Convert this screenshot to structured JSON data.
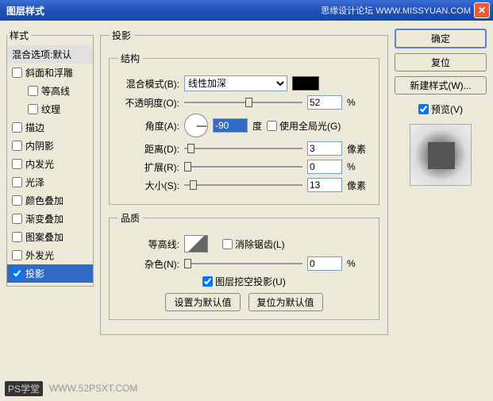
{
  "title": "图层样式",
  "brand": "思缘设计论坛  WWW.MISSYUAN.COM",
  "sidebar": {
    "legend": "样式",
    "blend": "混合选项:默认",
    "items": [
      {
        "label": "斜面和浮雕",
        "checked": false
      },
      {
        "label": "等高线",
        "checked": false,
        "sub": true
      },
      {
        "label": "纹理",
        "checked": false,
        "sub": true
      },
      {
        "label": "描边",
        "checked": false
      },
      {
        "label": "内阴影",
        "checked": false
      },
      {
        "label": "内发光",
        "checked": false
      },
      {
        "label": "光泽",
        "checked": false
      },
      {
        "label": "颜色叠加",
        "checked": false
      },
      {
        "label": "渐变叠加",
        "checked": false
      },
      {
        "label": "图案叠加",
        "checked": false
      },
      {
        "label": "外发光",
        "checked": false
      },
      {
        "label": "投影",
        "checked": true,
        "selected": true
      }
    ]
  },
  "center": {
    "legend": "投影",
    "structure": {
      "legend": "结构",
      "blend_mode_label": "混合模式(B):",
      "blend_mode_value": "线性加深",
      "opacity_label": "不透明度(O):",
      "opacity_value": "52",
      "opacity_unit": "%",
      "angle_label": "角度(A):",
      "angle_value": "-90",
      "angle_unit": "度",
      "global_light": "使用全局光(G)",
      "distance_label": "距离(D):",
      "distance_value": "3",
      "distance_unit": "像素",
      "spread_label": "扩展(R):",
      "spread_value": "0",
      "spread_unit": "%",
      "size_label": "大小(S):",
      "size_value": "13",
      "size_unit": "像素"
    },
    "quality": {
      "legend": "品质",
      "contour_label": "等高线:",
      "antialias": "消除锯齿(L)",
      "noise_label": "杂色(N):",
      "noise_value": "0",
      "noise_unit": "%",
      "knockout": "图层挖空投影(U)",
      "make_default": "设置为默认值",
      "reset_default": "复位为默认值"
    }
  },
  "right": {
    "ok": "确定",
    "cancel": "复位",
    "new_style": "新建样式(W)...",
    "preview": "预览(V)"
  },
  "footer": {
    "tag": "PS学堂",
    "url": "WWW.52PSXT.COM"
  }
}
